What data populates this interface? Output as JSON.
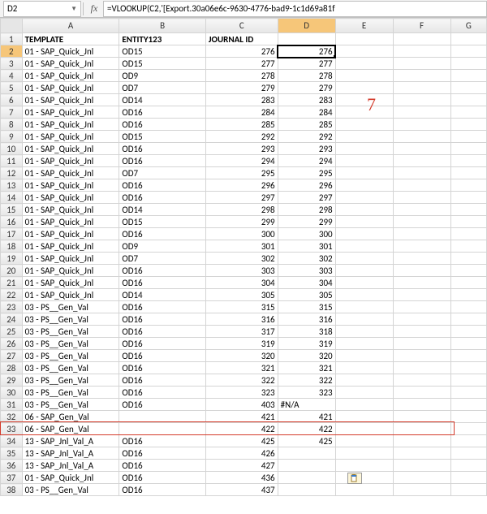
{
  "formula_bar": {
    "name_box": "D2",
    "fx_label": "fx",
    "formula": "=VLOOKUP(C2,'[Export.30a06e6c-9630-4776-bad9-1c1d69a81f"
  },
  "col_headers": [
    "A",
    "B",
    "C",
    "D",
    "E",
    "F",
    "G"
  ],
  "headers_row": {
    "A": "TEMPLATE",
    "B": "ENTITY123",
    "C": "JOURNAL ID"
  },
  "annotations": {
    "red_number": "7"
  },
  "highlight_row": 31,
  "selected_cell": "D2",
  "rows": [
    {
      "r": 2,
      "A": "01 - SAP_Quick_Jnl",
      "B": "OD15",
      "C": "276",
      "D": "276"
    },
    {
      "r": 3,
      "A": "01 - SAP_Quick_Jnl",
      "B": "OD15",
      "C": "277",
      "D": "277"
    },
    {
      "r": 4,
      "A": "01 - SAP_Quick_Jnl",
      "B": "OD9",
      "C": "278",
      "D": "278"
    },
    {
      "r": 5,
      "A": "01 - SAP_Quick_Jnl",
      "B": "OD7",
      "C": "279",
      "D": "279"
    },
    {
      "r": 6,
      "A": "01 - SAP_Quick_Jnl",
      "B": "OD14",
      "C": "283",
      "D": "283"
    },
    {
      "r": 7,
      "A": "01 - SAP_Quick_Jnl",
      "B": "OD16",
      "C": "284",
      "D": "284"
    },
    {
      "r": 8,
      "A": "01 - SAP_Quick_Jnl",
      "B": "OD16",
      "C": "285",
      "D": "285"
    },
    {
      "r": 9,
      "A": "01 - SAP_Quick_Jnl",
      "B": "OD15",
      "C": "292",
      "D": "292"
    },
    {
      "r": 10,
      "A": "01 - SAP_Quick_Jnl",
      "B": "OD16",
      "C": "293",
      "D": "293"
    },
    {
      "r": 11,
      "A": "01 - SAP_Quick_Jnl",
      "B": "OD16",
      "C": "294",
      "D": "294"
    },
    {
      "r": 12,
      "A": "01 - SAP_Quick_Jnl",
      "B": "OD7",
      "C": "295",
      "D": "295"
    },
    {
      "r": 13,
      "A": "01 - SAP_Quick_Jnl",
      "B": "OD16",
      "C": "296",
      "D": "296"
    },
    {
      "r": 14,
      "A": "01 - SAP_Quick_Jnl",
      "B": "OD16",
      "C": "297",
      "D": "297"
    },
    {
      "r": 15,
      "A": "01 - SAP_Quick_Jnl",
      "B": "OD14",
      "C": "298",
      "D": "298"
    },
    {
      "r": 16,
      "A": "01 - SAP_Quick_Jnl",
      "B": "OD15",
      "C": "299",
      "D": "299"
    },
    {
      "r": 17,
      "A": "01 - SAP_Quick_Jnl",
      "B": "OD16",
      "C": "300",
      "D": "300"
    },
    {
      "r": 18,
      "A": "01 - SAP_Quick_Jnl",
      "B": "OD9",
      "C": "301",
      "D": "301"
    },
    {
      "r": 19,
      "A": "01 - SAP_Quick_Jnl",
      "B": "OD7",
      "C": "302",
      "D": "302"
    },
    {
      "r": 20,
      "A": "01 - SAP_Quick_Jnl",
      "B": "OD16",
      "C": "303",
      "D": "303"
    },
    {
      "r": 21,
      "A": "01 - SAP_Quick_Jnl",
      "B": "OD16",
      "C": "304",
      "D": "304"
    },
    {
      "r": 22,
      "A": "01 - SAP_Quick_Jnl",
      "B": "OD14",
      "C": "305",
      "D": "305"
    },
    {
      "r": 23,
      "A": "03 - PS__Gen_Val",
      "B": "OD16",
      "C": "315",
      "D": "315"
    },
    {
      "r": 24,
      "A": "03 - PS__Gen_Val",
      "B": "OD16",
      "C": "316",
      "D": "316"
    },
    {
      "r": 25,
      "A": "03 - PS__Gen_Val",
      "B": "OD16",
      "C": "317",
      "D": "318"
    },
    {
      "r": 26,
      "A": "03 - PS__Gen_Val",
      "B": "OD16",
      "C": "319",
      "D": "319"
    },
    {
      "r": 27,
      "A": "03 - PS__Gen_Val",
      "B": "OD16",
      "C": "320",
      "D": "320"
    },
    {
      "r": 28,
      "A": "03 - PS__Gen_Val",
      "B": "OD16",
      "C": "321",
      "D": "321"
    },
    {
      "r": 29,
      "A": "03 - PS__Gen_Val",
      "B": "OD16",
      "C": "322",
      "D": "322"
    },
    {
      "r": 30,
      "A": "03 - PS__Gen_Val",
      "B": "OD16",
      "C": "323",
      "D": "323"
    },
    {
      "r": 31,
      "A": "03 - PS__Gen_Val",
      "B": "OD16",
      "C": "403",
      "D": "#N/A"
    },
    {
      "r": 32,
      "A": "06 - SAP_Gen_Val",
      "B": "",
      "C": "421",
      "D": "421"
    },
    {
      "r": 33,
      "A": "06 - SAP_Gen_Val",
      "B": "",
      "C": "422",
      "D": "422"
    },
    {
      "r": 34,
      "A": "13 - SAP_Jnl_Val_A",
      "B": "OD16",
      "C": "425",
      "D": "425"
    },
    {
      "r": 35,
      "A": "13 - SAP_Jnl_Val_A",
      "B": "OD16",
      "C": "426",
      "D": ""
    },
    {
      "r": 36,
      "A": "13 - SAP_Jnl_Val_A",
      "B": "OD16",
      "C": "427",
      "D": ""
    },
    {
      "r": 37,
      "A": "01 - SAP_Quick_Jnl",
      "B": "OD16",
      "C": "436",
      "D": ""
    },
    {
      "r": 38,
      "A": "03 - PS__Gen_Val",
      "B": "OD16",
      "C": "437",
      "D": ""
    }
  ]
}
